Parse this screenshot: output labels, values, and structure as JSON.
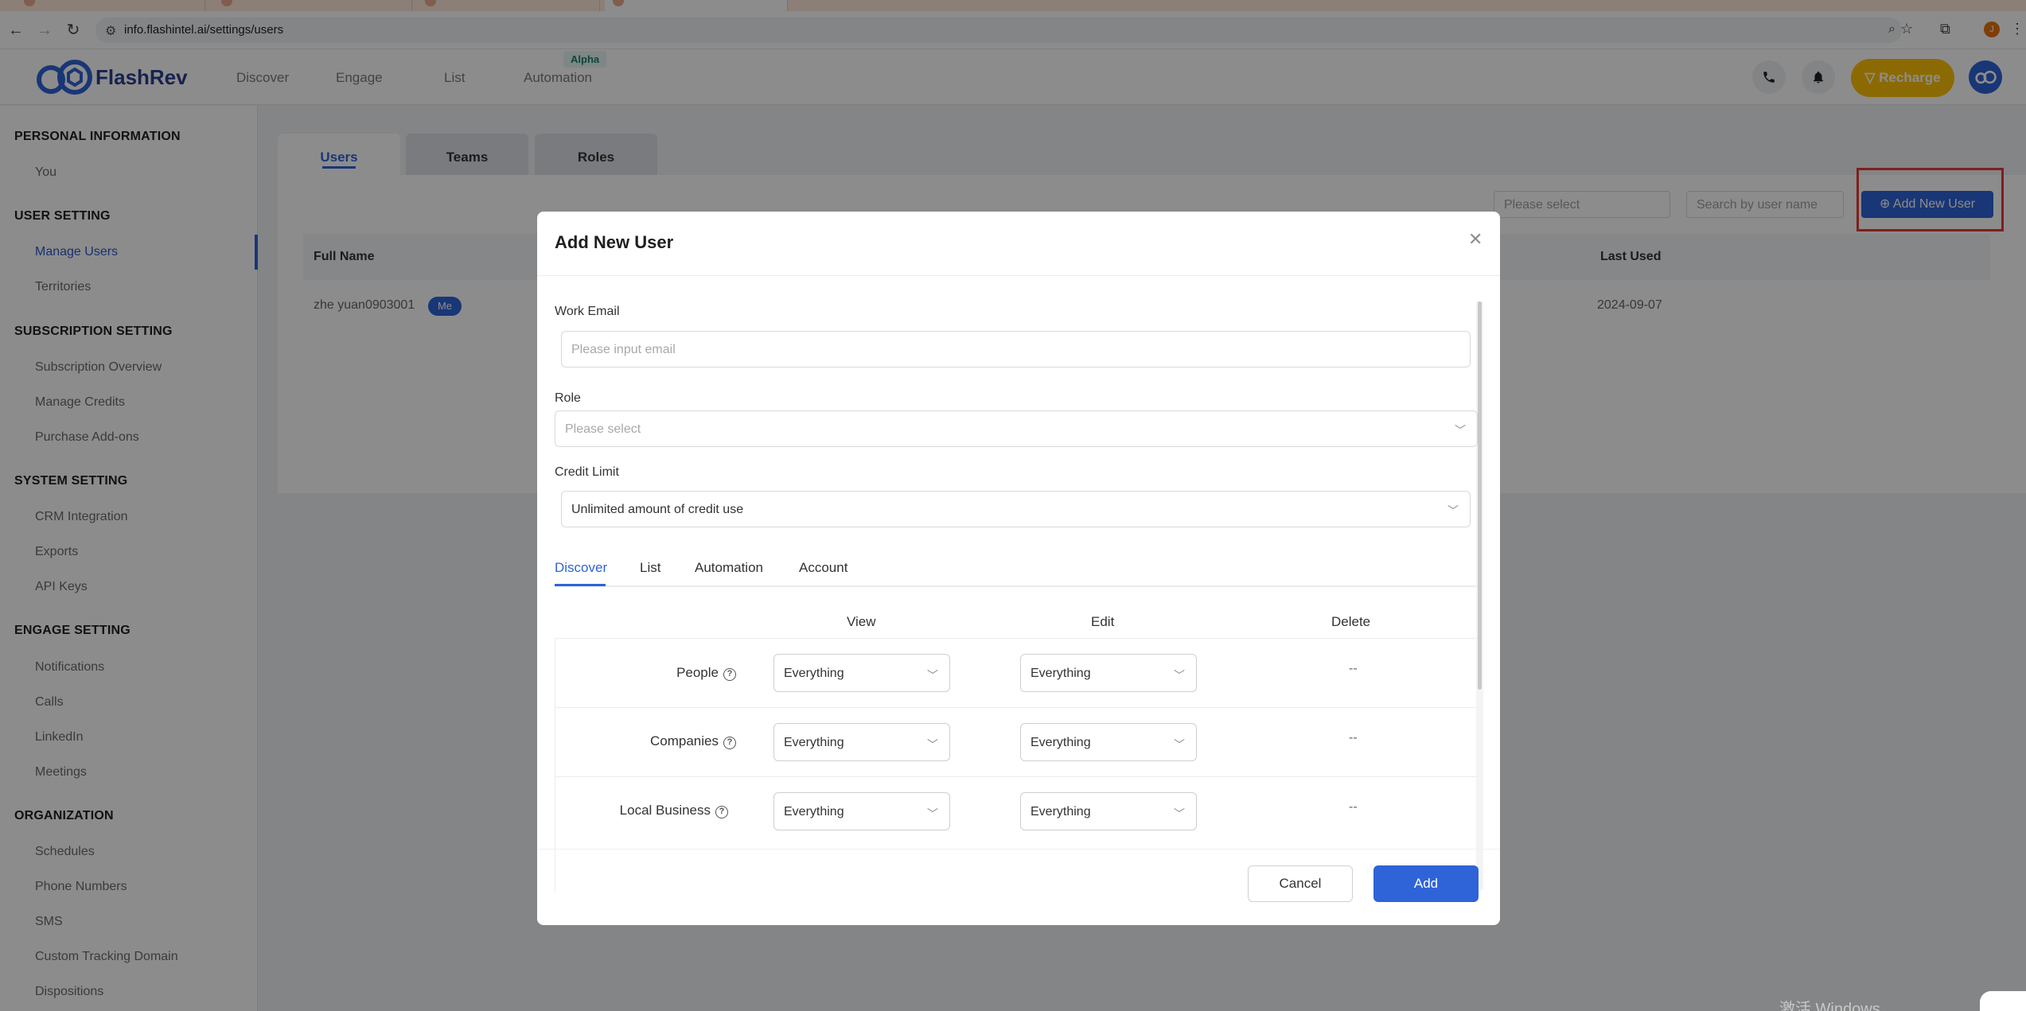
{
  "browser": {
    "url": "info.flashintel.ai/settings/users",
    "profile_initial": "J"
  },
  "app": {
    "logo_text": "FlashRev",
    "nav": [
      "Discover",
      "Engage",
      "List",
      "Automation"
    ],
    "alpha_badge": "Alpha",
    "recharge_label": "Recharge"
  },
  "sidebar": {
    "sections": [
      {
        "title": "PERSONAL INFORMATION",
        "items": [
          "You"
        ]
      },
      {
        "title": "USER SETTING",
        "items": [
          "Manage Users",
          "Territories"
        ]
      },
      {
        "title": "SUBSCRIPTION SETTING",
        "items": [
          "Subscription Overview",
          "Manage Credits",
          "Purchase Add-ons"
        ]
      },
      {
        "title": "SYSTEM SETTING",
        "items": [
          "CRM Integration",
          "Exports",
          "API Keys"
        ]
      },
      {
        "title": "ENGAGE SETTING",
        "items": [
          "Notifications",
          "Calls",
          "LinkedIn",
          "Meetings"
        ]
      },
      {
        "title": "ORGANIZATION",
        "items": [
          "Schedules",
          "Phone Numbers",
          "SMS",
          "Custom Tracking Domain",
          "Dispositions"
        ]
      }
    ],
    "active_item": "Manage Users"
  },
  "main": {
    "tabs": [
      "Users",
      "Teams",
      "Roles"
    ],
    "filter_placeholder": "Please select",
    "search_placeholder": "Search by user name",
    "add_user_label": "Add New User",
    "columns": {
      "full_name": "Full Name",
      "last_used": "Last Used"
    },
    "rows": [
      {
        "full_name": "zhe yuan0903001",
        "badge": "Me",
        "last_used": "2024-09-07"
      }
    ]
  },
  "modal": {
    "title": "Add New User",
    "work_email_label": "Work Email",
    "work_email_placeholder": "Please input email",
    "role_label": "Role",
    "role_placeholder": "Please select",
    "credit_limit_label": "Credit Limit",
    "credit_limit_value": "Unlimited amount of credit use",
    "perm_tabs": [
      "Discover",
      "List",
      "Automation",
      "Account"
    ],
    "perm_columns": [
      "View",
      "Edit",
      "Delete"
    ],
    "perm_rows": [
      {
        "label": "People",
        "view": "Everything",
        "edit": "Everything",
        "delete": "--"
      },
      {
        "label": "Companies",
        "view": "Everything",
        "edit": "Everything",
        "delete": "--"
      },
      {
        "label": "Local Business",
        "view": "Everything",
        "edit": "Everything",
        "delete": "--"
      }
    ],
    "cancel_label": "Cancel",
    "add_label": "Add"
  },
  "os": {
    "watermark": "激活 Windows"
  },
  "colors": {
    "primary": "#2f63d8",
    "recharge": "#ffc107",
    "highlight": "#e53935"
  }
}
